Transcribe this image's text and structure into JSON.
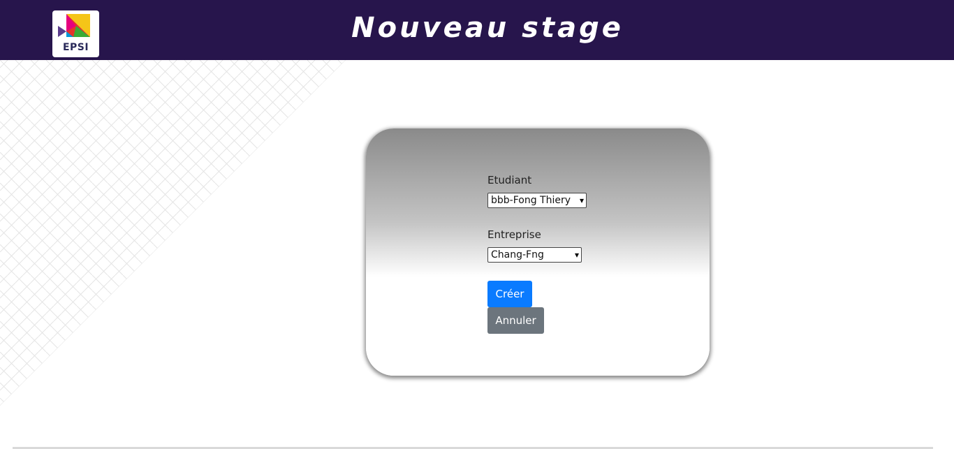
{
  "header": {
    "title": "Nouveau stage",
    "logo_text": "EPSI",
    "background_color": "#27154c"
  },
  "form": {
    "etudiant_label": "Etudiant",
    "etudiant_value": "bbb-Fong Thiery",
    "entreprise_label": "Entreprise",
    "entreprise_value": "Chang-Fng",
    "create_button": "Créer",
    "cancel_button": "Annuler"
  },
  "colors": {
    "primary_button": "#0a7bff",
    "secondary_button": "#6c757d"
  }
}
